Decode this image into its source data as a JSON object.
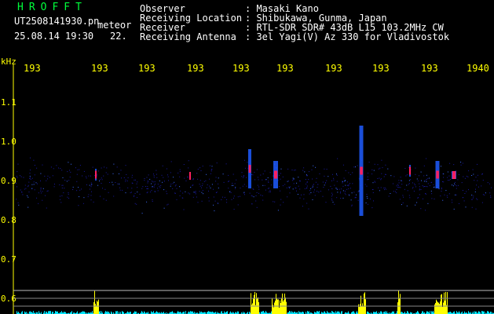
{
  "header": {
    "brand": "HROFFT",
    "filename": "UT2508141930.pn",
    "meteor_label": "meteor",
    "datetime": "25.08.14 19:30",
    "count": "22.",
    "fields": [
      {
        "label": "Observer",
        "value": ": Masaki Kano"
      },
      {
        "label": "Receiving Location",
        "value": ": Shibukawa, Gunma, Japan"
      },
      {
        "label": "Receiver",
        "value": ": RTL-SDR SDR# 43dB L15 103.2MHz CW"
      },
      {
        "label": "Receiving Antenna",
        "value": ": 3el Yagi(V) Az 330 for Vladivostok"
      }
    ]
  },
  "axis": {
    "unit": "kHz",
    "x_ticks": [
      "193",
      "193",
      "193",
      "193",
      "193",
      "193",
      "193",
      "193",
      "193",
      "1940"
    ],
    "y_ticks": [
      "1.1",
      "1.0",
      "0.9",
      "0.8",
      "0.7",
      "0.6"
    ]
  },
  "colors": {
    "brand": "#00ff3c",
    "text": "#ffffff",
    "axis": "#ffff00",
    "background": "#000000",
    "noise": "#1a1aa0",
    "echo_hot": "#ff2060",
    "bar_yellow": "#ffff00",
    "bar_cyan": "#00e5ff"
  }
}
